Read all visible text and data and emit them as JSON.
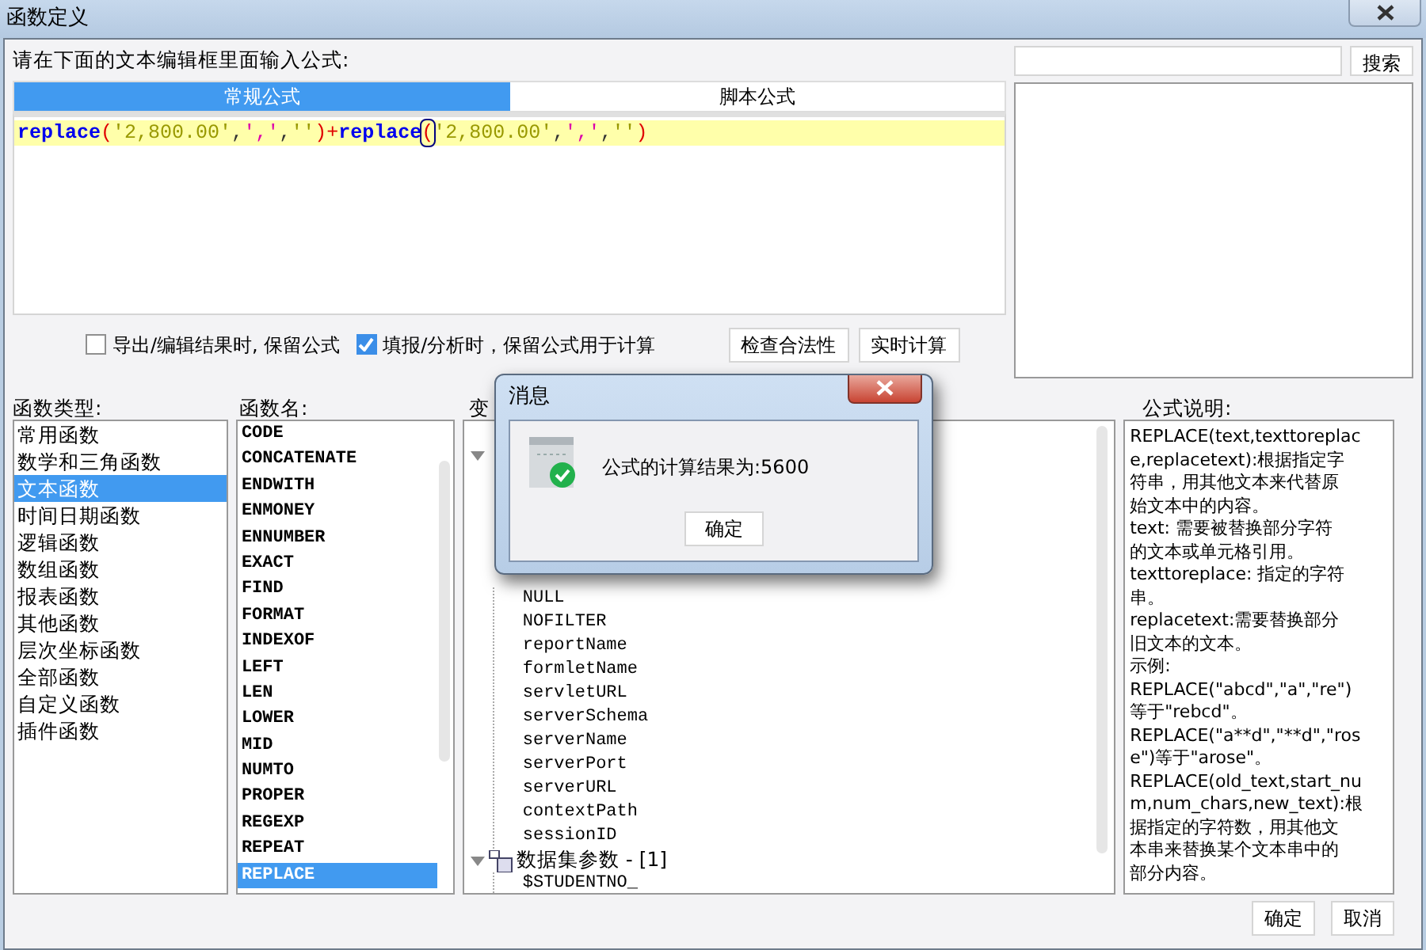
{
  "window": {
    "title": "函数定义"
  },
  "editor": {
    "prompt": "请在下面的文本编辑框里面输入公式:",
    "tabs": [
      {
        "label": "常规公式",
        "selected": true
      },
      {
        "label": "脚本公式",
        "selected": false
      }
    ],
    "formula": [
      {
        "kind": "func",
        "text": "replace",
        "caret": false
      },
      {
        "kind": "paren",
        "text": "(",
        "caret": false
      },
      {
        "kind": "string",
        "text": "'2,800.00'",
        "caret": false
      },
      {
        "kind": "sep",
        "text": ",",
        "caret": false
      },
      {
        "kind": "quote",
        "text": "','",
        "caret": false
      },
      {
        "kind": "sep",
        "text": ",",
        "caret": false
      },
      {
        "kind": "string",
        "text": "''",
        "caret": false
      },
      {
        "kind": "paren",
        "text": ")",
        "caret": false
      },
      {
        "kind": "paren",
        "text": "+",
        "caret": false
      },
      {
        "kind": "func",
        "text": "replace",
        "caret": false
      },
      {
        "kind": "paren",
        "text": "(",
        "caret": true
      },
      {
        "kind": "string",
        "text": "'2,800.00'",
        "caret": false
      },
      {
        "kind": "sep",
        "text": ",",
        "caret": false
      },
      {
        "kind": "quote",
        "text": "','",
        "caret": false
      },
      {
        "kind": "sep",
        "text": ",",
        "caret": false
      },
      {
        "kind": "string",
        "text": "''",
        "caret": false
      },
      {
        "kind": "paren",
        "text": ")",
        "caret": false
      }
    ]
  },
  "options": [
    {
      "label": "导出/编辑结果时, 保留公式",
      "checked": false
    },
    {
      "label": "填报/分析时，保留公式用于计算",
      "checked": true
    }
  ],
  "actions": [
    "检查合法性",
    "实时计算"
  ],
  "search": {
    "button": "搜索"
  },
  "function_types": {
    "label": "函数类型:",
    "items": [
      {
        "text": "常用函数",
        "selected": false
      },
      {
        "text": "数学和三角函数",
        "selected": false
      },
      {
        "text": "文本函数",
        "selected": true
      },
      {
        "text": "时间日期函数",
        "selected": false
      },
      {
        "text": "逻辑函数",
        "selected": false
      },
      {
        "text": "数组函数",
        "selected": false
      },
      {
        "text": "报表函数",
        "selected": false
      },
      {
        "text": "其他函数",
        "selected": false
      },
      {
        "text": "层次坐标函数",
        "selected": false
      },
      {
        "text": "全部函数",
        "selected": false
      },
      {
        "text": "自定义函数",
        "selected": false
      },
      {
        "text": "插件函数",
        "selected": false
      }
    ]
  },
  "function_names": {
    "label": "函数名:",
    "items": [
      {
        "text": "CODE",
        "selected": false
      },
      {
        "text": "CONCATENATE",
        "selected": false
      },
      {
        "text": "ENDWITH",
        "selected": false
      },
      {
        "text": "ENMONEY",
        "selected": false
      },
      {
        "text": "ENNUMBER",
        "selected": false
      },
      {
        "text": "EXACT",
        "selected": false
      },
      {
        "text": "FIND",
        "selected": false
      },
      {
        "text": "FORMAT",
        "selected": false
      },
      {
        "text": "INDEXOF",
        "selected": false
      },
      {
        "text": "LEFT",
        "selected": false
      },
      {
        "text": "LEN",
        "selected": false
      },
      {
        "text": "LOWER",
        "selected": false
      },
      {
        "text": "MID",
        "selected": false
      },
      {
        "text": "NUMTO",
        "selected": false
      },
      {
        "text": "PROPER",
        "selected": false
      },
      {
        "text": "REGEXP",
        "selected": false
      },
      {
        "text": "REPEAT",
        "selected": false
      },
      {
        "text": "REPLACE",
        "selected": true
      }
    ]
  },
  "variables": {
    "label": "变",
    "tree": [
      {
        "expanded": true,
        "children": [
          {
            "text": "NULL"
          },
          {
            "text": "NOFILTER"
          },
          {
            "text": "reportName"
          },
          {
            "text": "formletName"
          },
          {
            "text": "servletURL"
          },
          {
            "text": "serverSchema"
          },
          {
            "text": "serverName"
          },
          {
            "text": "serverPort"
          },
          {
            "text": "serverURL"
          },
          {
            "text": "contextPath"
          },
          {
            "text": "sessionID"
          }
        ]
      },
      {
        "text": "数据集参数 - [1]",
        "expanded": true,
        "children": [
          {
            "text": "$STUDENTNO_"
          }
        ]
      }
    ]
  },
  "description": {
    "label": "公式说明:",
    "lines": [
      "REPLACE(text,texttoreplac",
      "e,replacetext):根据指定字",
      "符串，用其他文本来代替原",
      "始文本中的内容。",
      "text: 需要被替换部分字符",
      "的文本或单元格引用。",
      "texttoreplace: 指定的字符",
      "串。",
      "replacetext:需要替换部分",
      "旧文本的文本。",
      "示例:",
      "REPLACE(\"abcd\",\"a\",\"re\")",
      "等于\"rebcd\"。",
      "REPLACE(\"a**d\",\"**d\",\"ros",
      "e\")等于\"arose\"。",
      "REPLACE(old_text,start_nu",
      "m,num_chars,new_text):根",
      "据指定的字符数，用其他文",
      "本串来替换某个文本串中的",
      "部分内容。"
    ]
  },
  "footer": [
    "确定",
    "取消"
  ],
  "message": {
    "title": "消息",
    "text": "公式的计算结果为:5600",
    "button": "确定"
  }
}
